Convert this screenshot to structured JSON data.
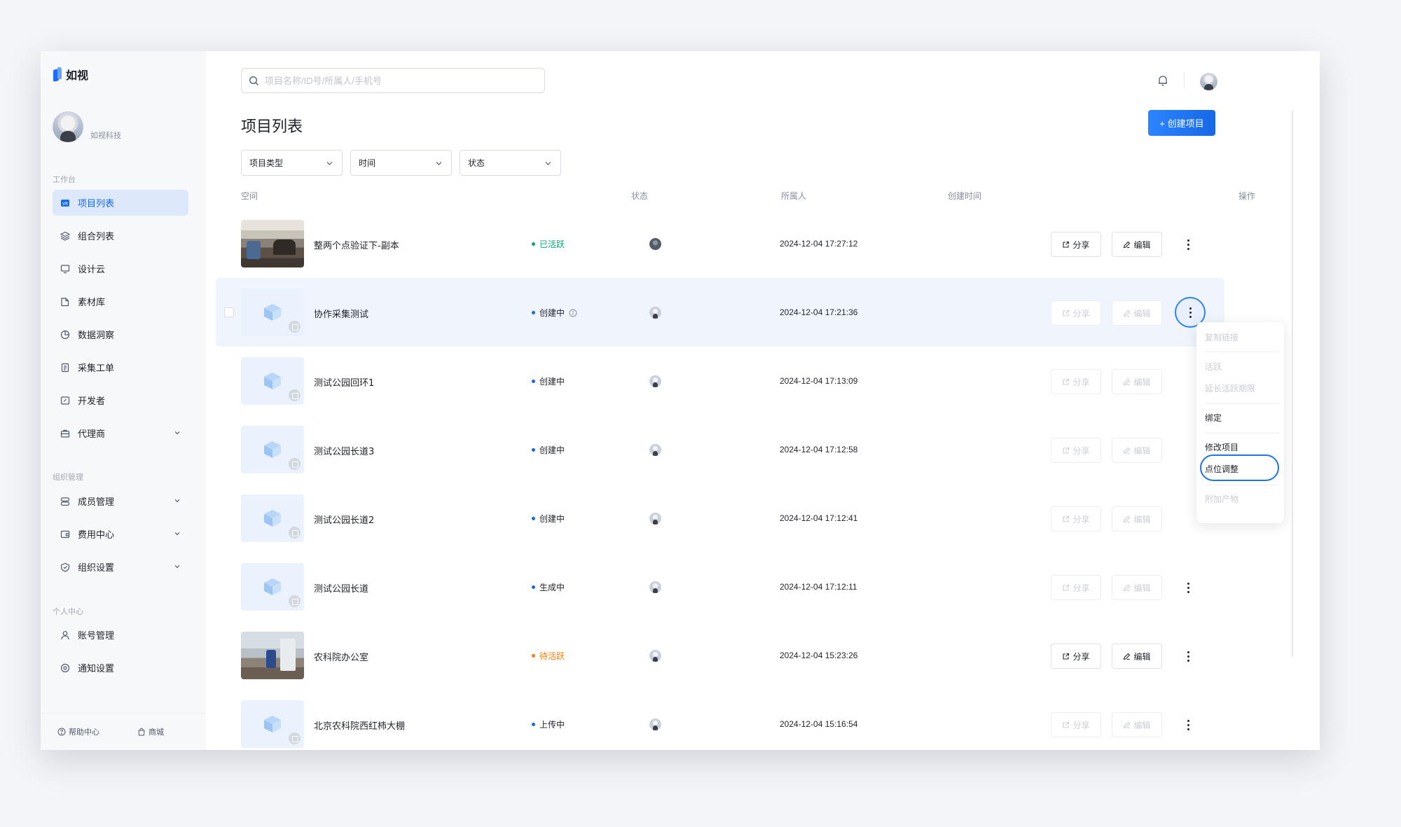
{
  "app": {
    "name": "如视"
  },
  "profile": {
    "org_name": "如视科技"
  },
  "sidebar": {
    "sections": [
      "工作台",
      "组织管理",
      "个人中心"
    ],
    "items": [
      {
        "label": "项目列表",
        "icon": "vr-badge-icon",
        "active": true
      },
      {
        "label": "组合列表",
        "icon": "layers-icon"
      },
      {
        "label": "设计云",
        "icon": "monitor-icon"
      },
      {
        "label": "素材库",
        "icon": "folder-icon"
      },
      {
        "label": "数据洞察",
        "icon": "pie-chart-icon"
      },
      {
        "label": "采集工单",
        "icon": "document-icon"
      },
      {
        "label": "开发者",
        "icon": "code-icon"
      },
      {
        "label": "代理商",
        "icon": "briefcase-icon",
        "expandable": true
      },
      {
        "label": "成员管理",
        "icon": "members-icon",
        "expandable": true
      },
      {
        "label": "费用中心",
        "icon": "wallet-icon",
        "expandable": true
      },
      {
        "label": "组织设置",
        "icon": "shield-icon",
        "expandable": true
      },
      {
        "label": "账号管理",
        "icon": "user-icon"
      },
      {
        "label": "通知设置",
        "icon": "settings-icon"
      }
    ],
    "footer": {
      "help": "帮助中心",
      "store": "商城"
    }
  },
  "search": {
    "placeholder": "项目名称/ID号/所属人/手机号",
    "value": ""
  },
  "page": {
    "title": "项目列表",
    "create_label": "+ 创建项目"
  },
  "filters": [
    "项目类型",
    "时间",
    "状态"
  ],
  "table": {
    "columns": [
      "空间",
      "状态",
      "所属人",
      "创建时间",
      "操作"
    ],
    "share_label": "分享",
    "edit_label": "编辑",
    "rows": [
      {
        "name": "整两个点验证下-副本",
        "status": "已活跃",
        "status_color": "#00a870",
        "time": "2024-12-04 17:27:12",
        "thumb": "photo",
        "enabled": true
      },
      {
        "name": "协作采集测试",
        "status": "创建中",
        "status_color": "#1f2329",
        "time": "2024-12-04 17:21:36",
        "thumb": "placeholder",
        "enabled": false,
        "info_icon": true,
        "highlighted": true
      },
      {
        "name": "测试公园回环1",
        "status": "创建中",
        "status_color": "#1f2329",
        "time": "2024-12-04 17:13:09",
        "thumb": "placeholder",
        "enabled": false
      },
      {
        "name": "测试公园长道3",
        "status": "创建中",
        "status_color": "#1f2329",
        "time": "2024-12-04 17:12:58",
        "thumb": "placeholder",
        "enabled": false
      },
      {
        "name": "测试公园长道2",
        "status": "创建中",
        "status_color": "#1f2329",
        "time": "2024-12-04 17:12:41",
        "thumb": "placeholder",
        "enabled": false
      },
      {
        "name": "测试公园长道",
        "status": "生成中",
        "status_color": "#1f2329",
        "time": "2024-12-04 17:12:11",
        "thumb": "placeholder",
        "enabled": false
      },
      {
        "name": "农科院办公室",
        "status": "待活跃",
        "status_color": "#ff7d00",
        "time": "2024-12-04 15:23:26",
        "thumb": "photo",
        "enabled": true
      },
      {
        "name": "北京农科院西红柿大棚",
        "status": "上传中",
        "status_color": "#1f2329",
        "time": "2024-12-04 15:16:54",
        "thumb": "placeholder",
        "enabled": false
      }
    ]
  },
  "dropdown": {
    "items": [
      {
        "label": "复制链接",
        "disabled": true
      },
      {
        "label": "活跃",
        "disabled": true
      },
      {
        "label": "延长活跃期限",
        "disabled": true
      },
      {
        "label": "绑定",
        "disabled": false
      },
      {
        "label": "修改项目",
        "disabled": false
      },
      {
        "label": "点位调整",
        "disabled": false,
        "highlighted": true
      },
      {
        "label": "附加产物",
        "disabled": true
      }
    ]
  },
  "colors": {
    "accent": "#1768e6",
    "active_status": "#00a870",
    "pending_status": "#ff7d00",
    "status_dot": "#1768e6"
  }
}
